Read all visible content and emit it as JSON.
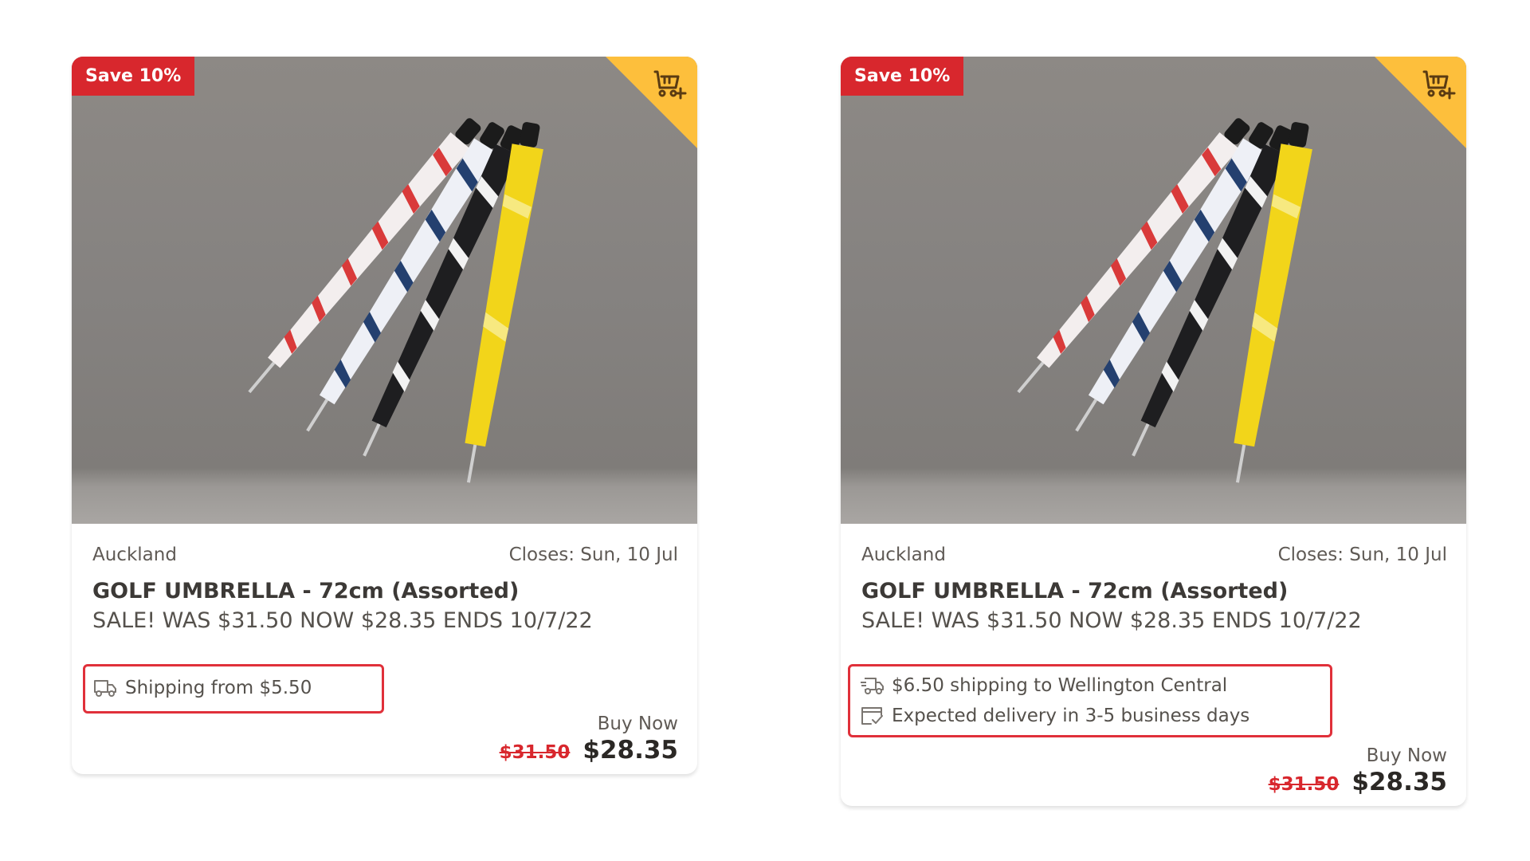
{
  "listings": [
    {
      "badge": "Save 10%",
      "watchlist_icon": "watchlist-add-icon",
      "location": "Auckland",
      "closes": "Closes: Sun, 10 Jul",
      "title": "GOLF UMBRELLA - 72cm (Assorted)",
      "subtitle": "SALE! WAS $31.50 NOW $28.35 ENDS 10/7/22",
      "shipping": [
        "Shipping from $5.50"
      ],
      "buy_label": "Buy Now",
      "old_price": "$31.50",
      "price": "$28.35"
    },
    {
      "badge": "Save 10%",
      "watchlist_icon": "watchlist-add-icon",
      "location": "Auckland",
      "closes": "Closes: Sun, 10 Jul",
      "title": "GOLF UMBRELLA - 72cm (Assorted)",
      "subtitle": "SALE! WAS $31.50 NOW $28.35 ENDS 10/7/22",
      "shipping": [
        "$6.50 shipping to Wellington Central",
        "Expected delivery in 3-5 business days"
      ],
      "buy_label": "Buy Now",
      "old_price": "$31.50",
      "price": "$28.35"
    }
  ],
  "colors": {
    "badge": "#d8272d",
    "watch_corner": "#fdbf3c",
    "highlight_box": "#e0303a"
  }
}
